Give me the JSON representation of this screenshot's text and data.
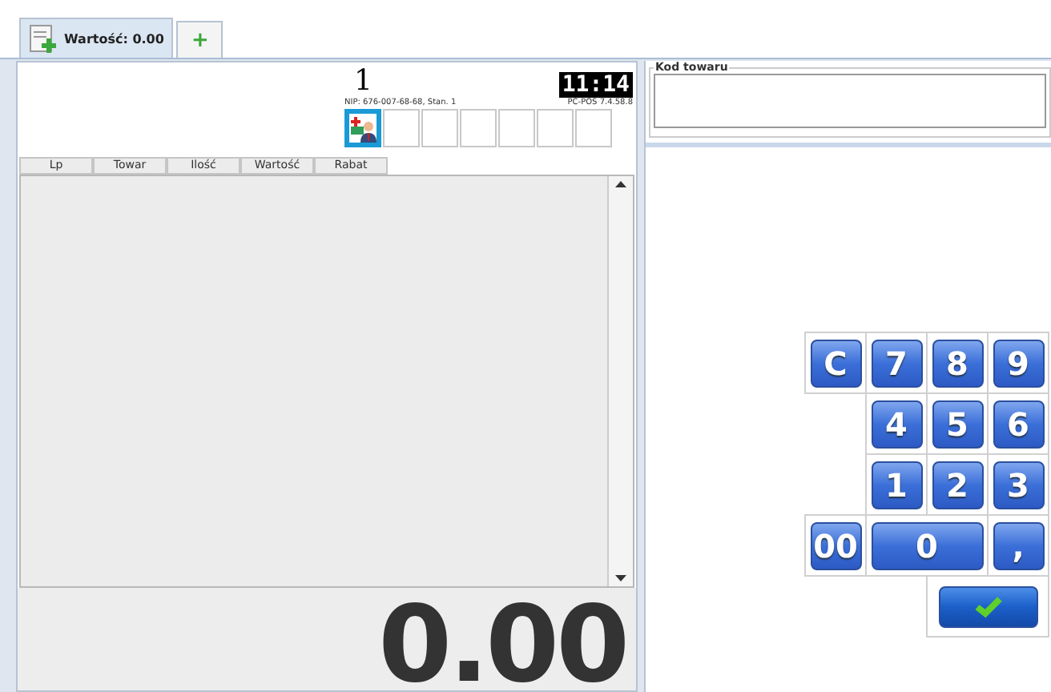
{
  "tabs": [
    {
      "label": "Wartość: 0.00",
      "kind": "receipt",
      "selected": true
    },
    {
      "label": "+",
      "kind": "add",
      "selected": false
    }
  ],
  "header": {
    "register_number": "1",
    "nip": "NIP: 676-007-68-68, Stan. 1",
    "clock": "11:14",
    "version": "PC-POS 7.4.58.8"
  },
  "tiles": [
    {
      "kind": "customer",
      "selected": true
    },
    {
      "kind": "empty",
      "selected": false
    },
    {
      "kind": "empty",
      "selected": false
    },
    {
      "kind": "empty",
      "selected": false
    },
    {
      "kind": "empty",
      "selected": false
    },
    {
      "kind": "empty",
      "selected": false
    },
    {
      "kind": "empty",
      "selected": false
    }
  ],
  "table": {
    "columns": [
      "Lp",
      "Towar",
      "Ilość",
      "Wartość",
      "Rabat"
    ]
  },
  "total": "0.00",
  "product_code": {
    "label": "Kod towaru"
  },
  "keypad": [
    {
      "kind": "key",
      "label": "C"
    },
    {
      "kind": "key",
      "label": "7"
    },
    {
      "kind": "key",
      "label": "8"
    },
    {
      "kind": "key",
      "label": "9"
    },
    {
      "kind": "spacer"
    },
    {
      "kind": "key",
      "label": "4"
    },
    {
      "kind": "key",
      "label": "5"
    },
    {
      "kind": "key",
      "label": "6"
    },
    {
      "kind": "spacer"
    },
    {
      "kind": "key",
      "label": "1"
    },
    {
      "kind": "key",
      "label": "2"
    },
    {
      "kind": "key",
      "label": "3"
    },
    {
      "kind": "key",
      "label": "00"
    },
    {
      "kind": "wide",
      "label": "0"
    },
    {
      "kind": "key",
      "label": ","
    },
    {
      "kind": "spacer"
    },
    {
      "kind": "spacer"
    },
    {
      "kind": "confirm"
    }
  ]
}
